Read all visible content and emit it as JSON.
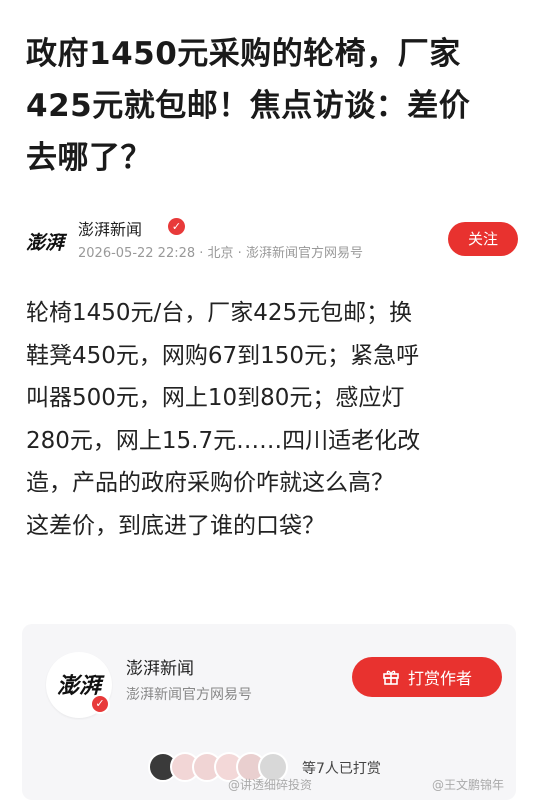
{
  "headline": {
    "lines": [
      "政府1450元采购的轮椅，厂家",
      "425元就包邮！焦点访谈：差价",
      "去哪了？"
    ]
  },
  "author": {
    "name": "澎湃新闻",
    "meta": "2026-05-22 22:28 · 北京 · 澎湃新闻官方网易号",
    "follow_label": "关注",
    "logo_text": "澎湃"
  },
  "body": {
    "lines": [
      "轮椅1450元/台，厂家425元包邮；换",
      "鞋凳450元，网购67到150元；紧急呼",
      "叫器500元，网上10到80元；感应灯",
      "280元，网上15.7元……四川适老化改",
      "造，产品的政府采购价咋就这么高？",
      "这差价，到底进了谁的口袋？"
    ]
  },
  "card": {
    "name": "澎湃新闻",
    "subtitle": "澎湃新闻官方网易号",
    "tip_label": "打赏作者",
    "supporters_text": "等7人已打赏",
    "logo_text": "澎湃",
    "avatar_colors": [
      "#3a3a3a",
      "#f2d6d6",
      "#f0d4d4",
      "#f3d8d8",
      "#e9cfcf",
      "#d8d8d8"
    ]
  },
  "watermarks": {
    "left": "@讲透细碎投资",
    "right": "@王文鹏锦年"
  },
  "colors": {
    "accent": "#e8322f"
  },
  "icons": {
    "verified": "verified-badge-icon",
    "gift": "gift-icon"
  }
}
